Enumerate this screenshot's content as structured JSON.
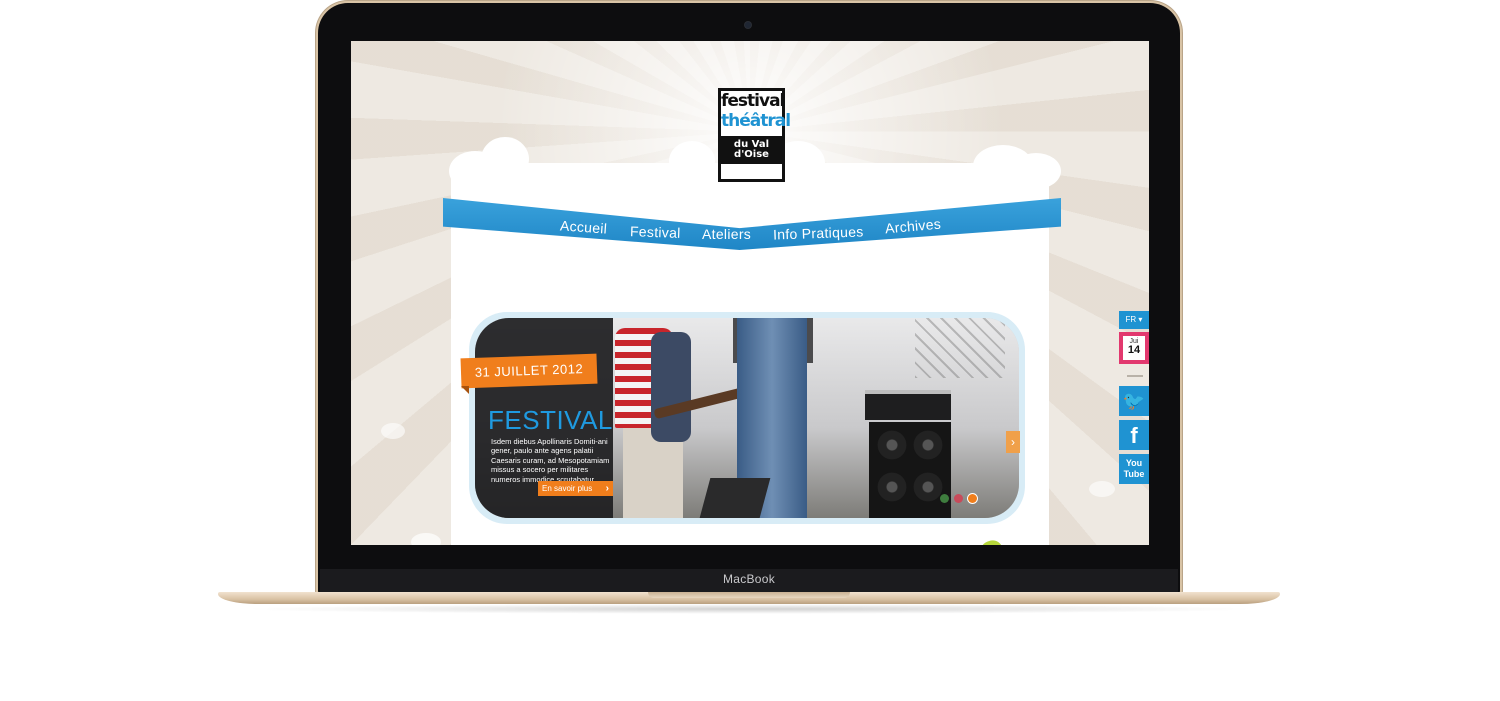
{
  "device": {
    "brand_label": "MacBook"
  },
  "logo": {
    "line1": "festival",
    "line2": "théâtral",
    "line3": "du Val d'Oise"
  },
  "nav": {
    "items": [
      {
        "label": "Accueil"
      },
      {
        "label": "Festival"
      },
      {
        "label": "Ateliers"
      },
      {
        "label": "Info Pratiques"
      },
      {
        "label": "Archives"
      }
    ]
  },
  "slider": {
    "date": "31 JUILLET 2012",
    "title": "FESTIVAL",
    "body": "Isdem diebus Apollinaris Domiti-ani gener, paulo ante agens palatii Caesaris curam, ad Mesopotamiam missus a socero per militares numeros immodice scrutabatur,",
    "button_label": "En savoir plus",
    "next_arrow": "›",
    "dots": [
      {
        "color": "#3e7d3e"
      },
      {
        "color": "#c84a5a"
      },
      {
        "color": "#f07e1c",
        "active": true
      }
    ]
  },
  "sidebar": {
    "language": "FR ▾",
    "calendar_month": "Jui",
    "calendar_day": "14",
    "twitter_icon": "twitter-bird-icon",
    "facebook_glyph": "f",
    "youtube_line1": "You",
    "youtube_line2": "Tube"
  },
  "colors": {
    "accent_blue": "#1f93d2",
    "accent_orange": "#f07e1c",
    "calendar_pink": "#e2386e"
  }
}
